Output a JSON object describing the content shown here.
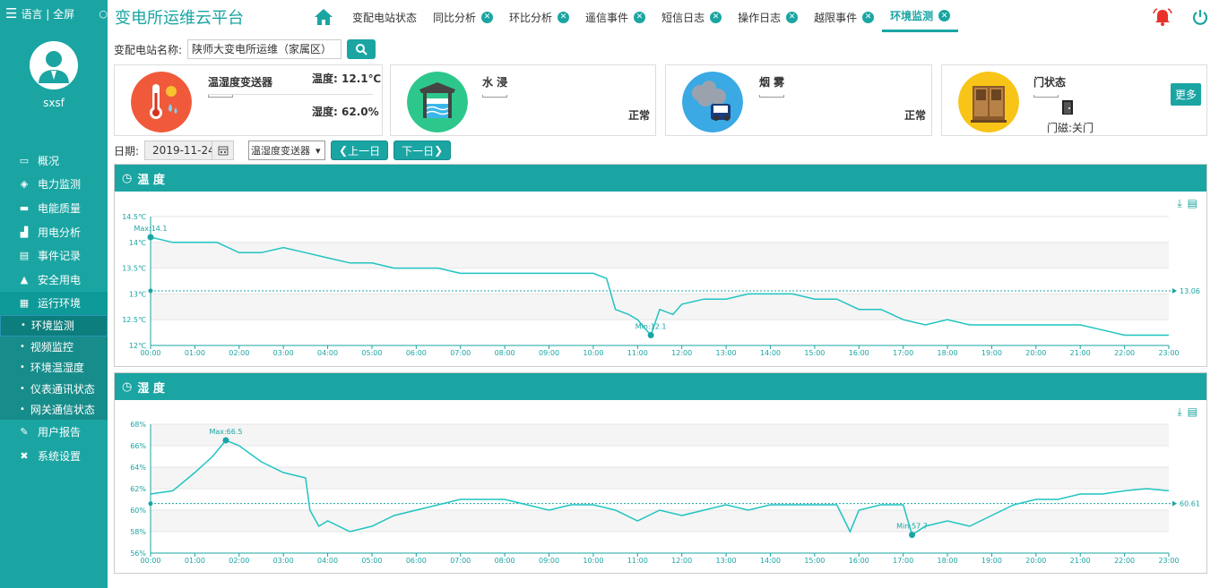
{
  "sidebar": {
    "top_text": "语言 | 全屏",
    "username": "sxsf",
    "nav": [
      {
        "label": "概况",
        "icon": "monitor-icon"
      },
      {
        "label": "电力监测",
        "icon": "power-icon"
      },
      {
        "label": "电能质量",
        "icon": "folder-icon"
      },
      {
        "label": "用电分析",
        "icon": "bar-chart-icon"
      },
      {
        "label": "事件记录",
        "icon": "document-icon"
      },
      {
        "label": "安全用电",
        "icon": "alarm-icon"
      },
      {
        "label": "运行环境",
        "icon": "environment-icon"
      }
    ],
    "subnav": [
      "环境监测",
      "视频监控",
      "环境温湿度",
      "仪表通讯状态",
      "网关通信状态"
    ],
    "nav_bottom": [
      {
        "label": "用户报告",
        "icon": "edit-icon"
      },
      {
        "label": "系统设置",
        "icon": "tools-icon"
      }
    ]
  },
  "header": {
    "title": "变电所运维云平台",
    "tabs": [
      {
        "label": "变配电站状态",
        "closable": false
      },
      {
        "label": "同比分析",
        "closable": true
      },
      {
        "label": "环比分析",
        "closable": true
      },
      {
        "label": "遥信事件",
        "closable": true
      },
      {
        "label": "短信日志",
        "closable": true
      },
      {
        "label": "操作日志",
        "closable": true
      },
      {
        "label": "越限事件",
        "closable": true
      },
      {
        "label": "环境监测",
        "closable": true,
        "active": true
      }
    ]
  },
  "station": {
    "label": "变配电站名称:",
    "value": "陕师大变电所运维（家属区）"
  },
  "cards": {
    "temp_sensor": {
      "name": "温湿度变送器",
      "temp_label": "温度:",
      "temp_value": "12.1℃",
      "hum_label": "湿度:",
      "hum_value": "62.0%"
    },
    "water": {
      "name": "水 浸",
      "status": "正常"
    },
    "smoke": {
      "name": "烟 雾",
      "status": "正常"
    },
    "door": {
      "name": "门状态",
      "door_text": "门磁:关门",
      "more": "更多"
    }
  },
  "toolbar": {
    "date_label": "日期:",
    "date_value": "2019-11-24",
    "select_value": "温湿度变送器",
    "prev": "上一日",
    "next": "下一日"
  },
  "chart_data": [
    {
      "type": "line",
      "title": "温 度",
      "unit": "℃",
      "ylim": [
        12,
        14.5
      ],
      "y_ticks": [
        12,
        12.5,
        13,
        13.5,
        14,
        14.5
      ],
      "x_ticks": [
        "00:00",
        "01:00",
        "02:00",
        "03:00",
        "04:00",
        "05:00",
        "06:00",
        "07:00",
        "08:00",
        "09:00",
        "10:00",
        "11:00",
        "12:00",
        "13:00",
        "14:00",
        "15:00",
        "16:00",
        "17:00",
        "18:00",
        "19:00",
        "20:00",
        "21:00",
        "22:00",
        "23:00"
      ],
      "x": [
        0,
        0.5,
        1,
        1.5,
        2,
        2.5,
        3,
        3.5,
        4,
        4.5,
        5,
        5.5,
        6,
        6.5,
        7,
        7.5,
        8,
        8.5,
        9,
        9.5,
        10,
        10.3,
        10.5,
        10.8,
        11,
        11.3,
        11.5,
        11.8,
        12,
        12.5,
        13,
        13.5,
        14,
        14.5,
        15,
        15.5,
        16,
        16.5,
        17,
        17.5,
        18,
        18.5,
        19,
        19.5,
        20,
        20.5,
        21,
        21.5,
        22,
        22.5,
        23
      ],
      "values": [
        14.1,
        14,
        14,
        14,
        13.8,
        13.8,
        13.9,
        13.8,
        13.7,
        13.6,
        13.6,
        13.5,
        13.5,
        13.5,
        13.4,
        13.4,
        13.4,
        13.4,
        13.4,
        13.4,
        13.4,
        13.3,
        12.7,
        12.6,
        12.5,
        12.2,
        12.7,
        12.6,
        12.8,
        12.9,
        12.9,
        13,
        13,
        13,
        12.9,
        12.9,
        12.7,
        12.7,
        12.5,
        12.4,
        12.5,
        12.4,
        12.4,
        12.4,
        12.4,
        12.4,
        12.4,
        12.3,
        12.2,
        12.2,
        12.2
      ],
      "avg": 13.06,
      "avg_label": "13.06",
      "max_label": "Max:14.1",
      "min_label": "Min:12.1"
    },
    {
      "type": "line",
      "title": "湿 度",
      "unit": "%",
      "ylim": [
        56,
        68
      ],
      "y_ticks": [
        56,
        58,
        60,
        62,
        64,
        66,
        68
      ],
      "x_ticks": [
        "00:00",
        "01:00",
        "02:00",
        "03:00",
        "04:00",
        "05:00",
        "06:00",
        "07:00",
        "08:00",
        "09:00",
        "10:00",
        "11:00",
        "12:00",
        "13:00",
        "14:00",
        "15:00",
        "16:00",
        "17:00",
        "18:00",
        "19:00",
        "20:00",
        "21:00",
        "22:00",
        "23:00"
      ],
      "x": [
        0,
        0.5,
        1,
        1.4,
        1.7,
        2,
        2.5,
        3,
        3.5,
        3.6,
        3.8,
        4,
        4.5,
        5,
        5.5,
        6,
        6.5,
        7,
        7.5,
        8,
        8.5,
        9,
        9.5,
        10,
        10.5,
        11,
        11.5,
        12,
        12.5,
        13,
        13.5,
        14,
        14.5,
        15,
        15.5,
        15.8,
        16,
        16.5,
        17,
        17.2,
        17.5,
        18,
        18.5,
        19,
        19.5,
        20,
        20.5,
        21,
        21.5,
        22,
        22.5,
        23
      ],
      "values": [
        61.5,
        61.8,
        63.5,
        65,
        66.5,
        66,
        64.5,
        63.5,
        63,
        60,
        58.5,
        59,
        58,
        58.5,
        59.5,
        60,
        60.5,
        61,
        61,
        61,
        60.5,
        60,
        60.5,
        60.5,
        60,
        59,
        60,
        59.5,
        60,
        60.5,
        60,
        60.5,
        60.5,
        60.5,
        60.5,
        58,
        60,
        60.5,
        60.5,
        57.7,
        58.5,
        59,
        58.5,
        59.5,
        60.5,
        61,
        61,
        61.5,
        61.5,
        61.8,
        62,
        61.8
      ],
      "avg": 60.61,
      "avg_label": "60.61",
      "max_label": "Max:66.5",
      "min_label": "Min:57.7"
    }
  ]
}
